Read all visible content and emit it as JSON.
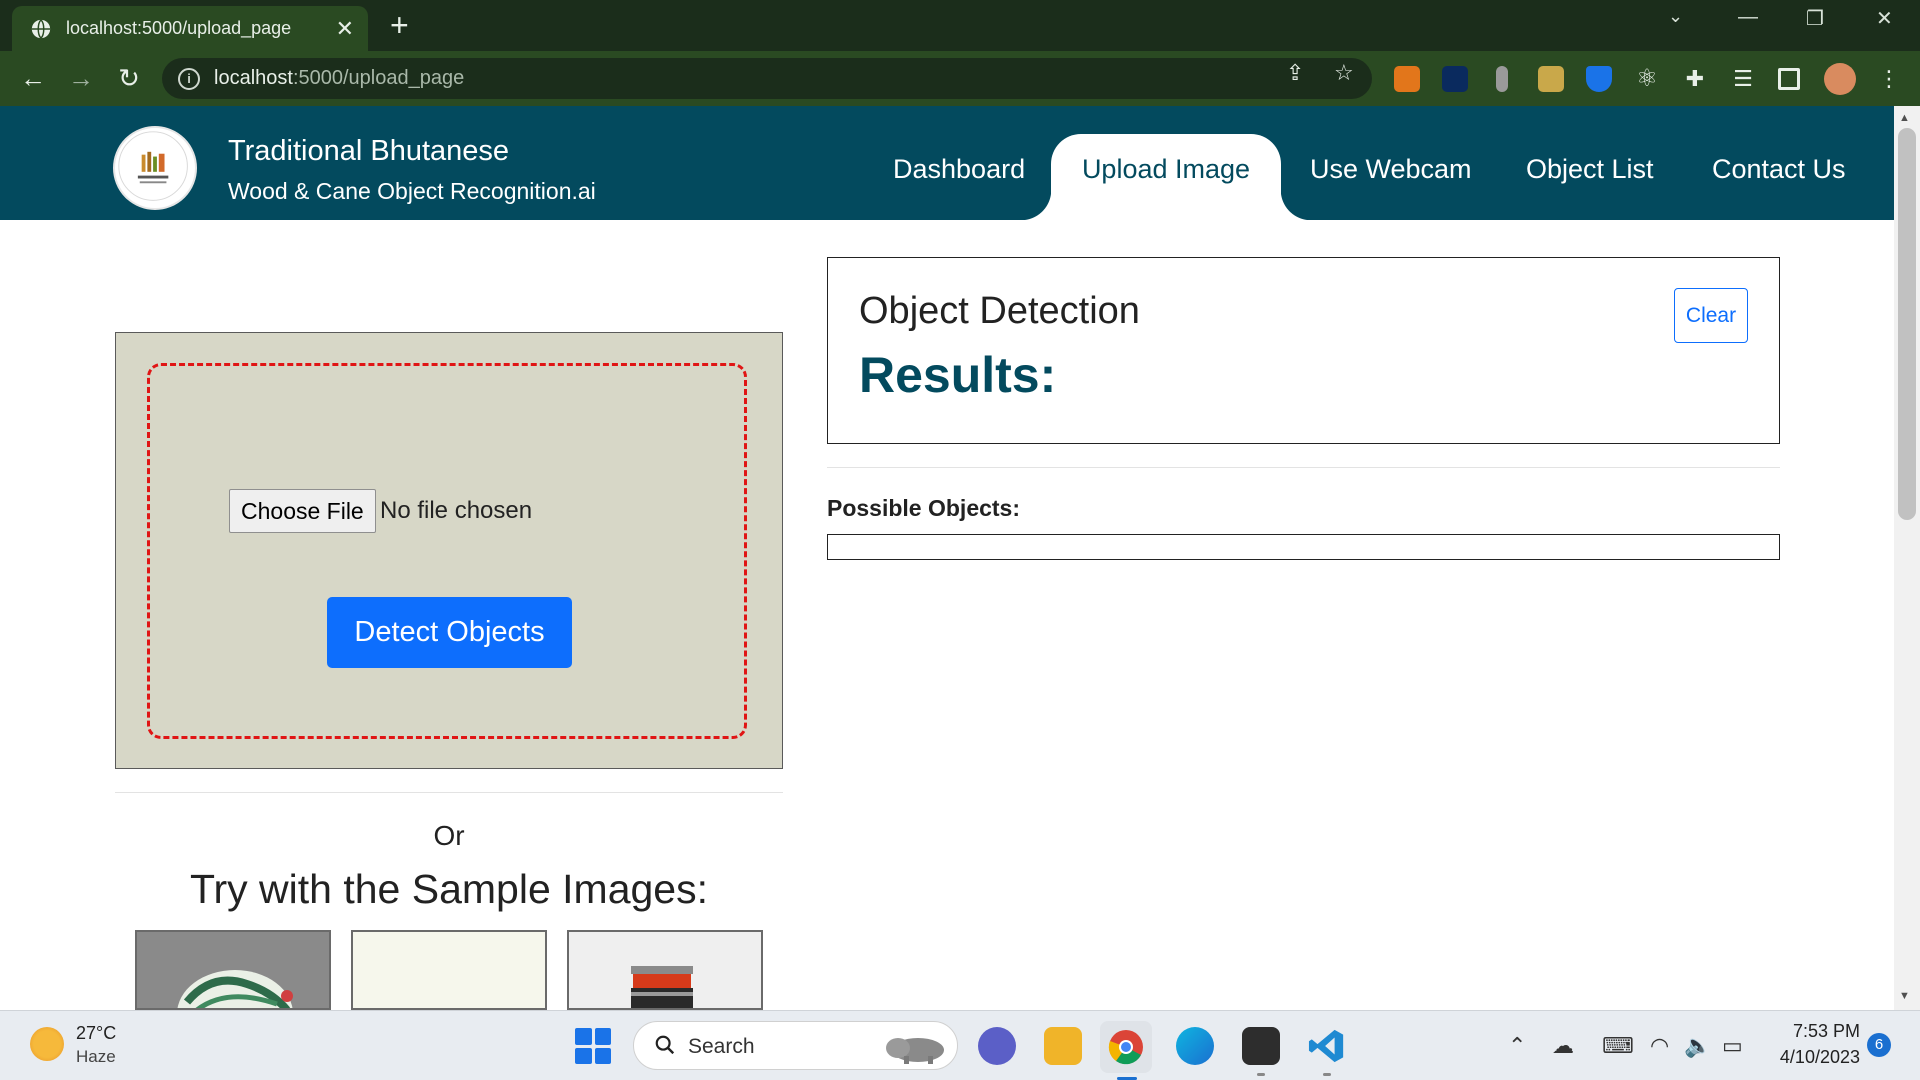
{
  "browser": {
    "tab_title": "localhost:5000/upload_page",
    "url_host": "localhost",
    "url_path": ":5000/upload_page"
  },
  "site": {
    "brand_title": "Traditional Bhutanese",
    "brand_subtitle": "Wood & Cane Object Recognition.ai",
    "nav": [
      {
        "label": "Dashboard",
        "active": false
      },
      {
        "label": "Upload Image",
        "active": true
      },
      {
        "label": "Use Webcam",
        "active": false
      },
      {
        "label": "Object List",
        "active": false
      },
      {
        "label": "Contact Us",
        "active": false
      }
    ],
    "accent_color": "#034a5e"
  },
  "upload": {
    "choose_file_label": "Choose File",
    "no_file_text": "No file chosen",
    "detect_button": "Detect Objects",
    "or_text": "Or",
    "sample_heading": "Try with the Sample Images:"
  },
  "results": {
    "title": "Object Detection",
    "subtitle": "Results:",
    "clear_button": "Clear",
    "possible_label": "Possible Objects:"
  },
  "taskbar": {
    "temperature": "27°C",
    "condition": "Haze",
    "search_placeholder": "Search",
    "time": "7:53 PM",
    "date": "4/10/2023",
    "notifications": "6"
  }
}
